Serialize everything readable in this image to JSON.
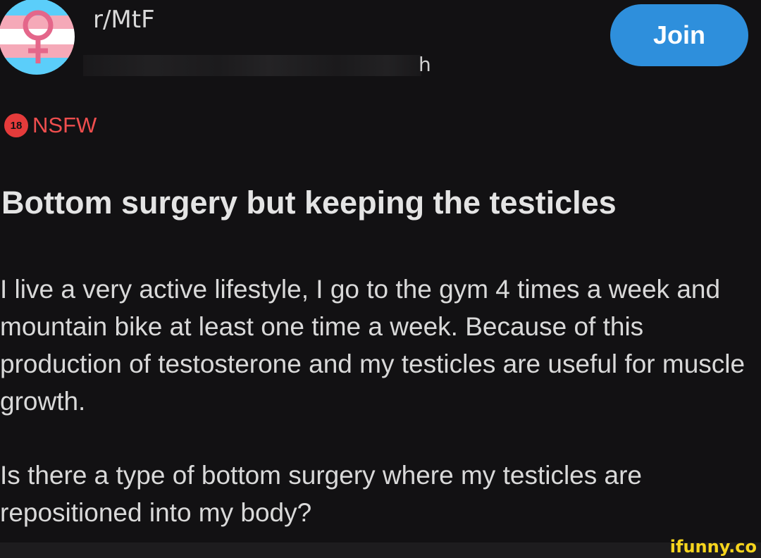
{
  "header": {
    "subreddit": "r/MtF",
    "username_fragment": "h",
    "join_label": "Join",
    "avatar_icon": "female-symbol-icon",
    "avatar_colors": [
      "#5bcefa",
      "#f5a9b8",
      "#ffffff"
    ]
  },
  "badge": {
    "age_label": "18",
    "nsfw_label": "NSFW",
    "color": "#ef4e4e"
  },
  "post": {
    "title": "Bottom surgery but keeping the testicles",
    "paragraphs": [
      "I live a very active lifestyle, I go to the gym 4 times a week and mountain bike at least one time a week. Because of this production of testosterone and my testicles are useful for muscle growth.",
      "Is there a type of bottom surgery where my testicles are repositioned into my body?"
    ]
  },
  "watermark": "ifunny.co",
  "colors": {
    "background": "#121113",
    "join_button": "#2e8fdc",
    "watermark": "#f7d51d"
  }
}
